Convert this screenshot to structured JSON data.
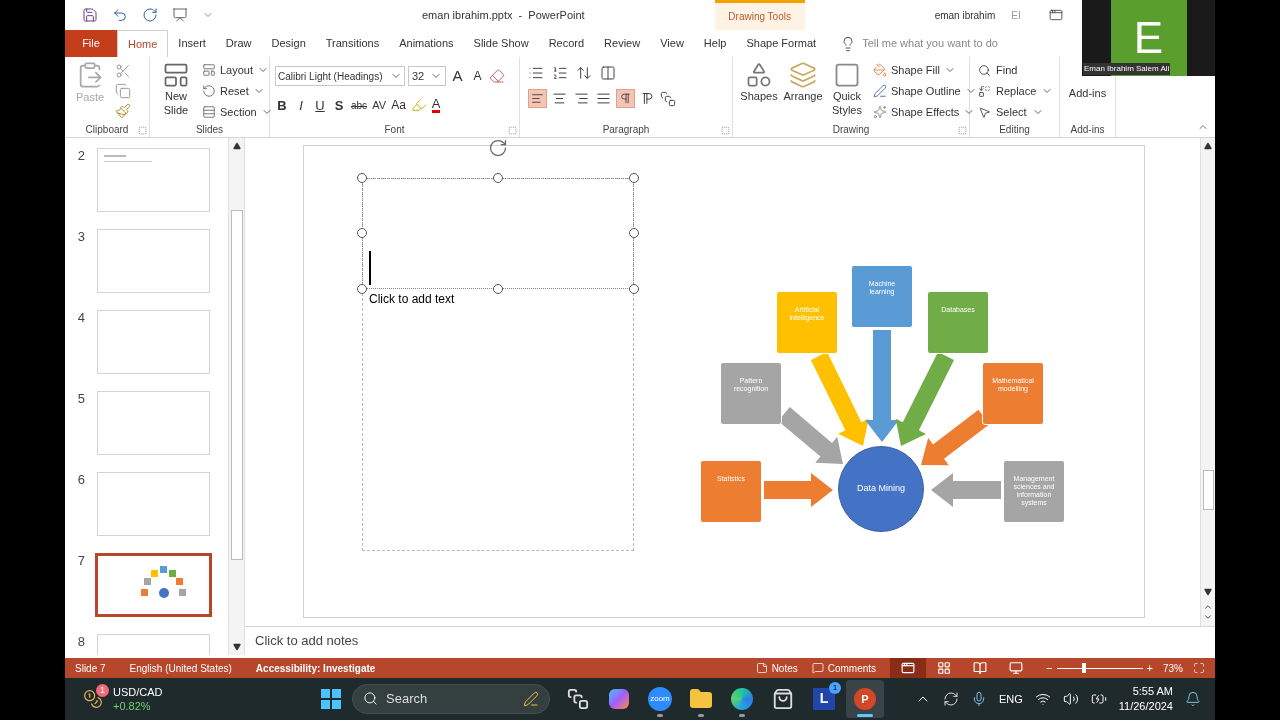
{
  "title_bar": {
    "title": "eman ibrahim.pptx  -  PowerPoint",
    "context_tab": "Drawing Tools",
    "user_name": "eman ibrahim",
    "user_initials": "EI"
  },
  "video_tile": {
    "letter": "E",
    "name": "Eman Ibrahim Salem Ali"
  },
  "tabs": [
    {
      "label": "File",
      "kind": "file",
      "selected": false
    },
    {
      "label": "Home",
      "kind": "tab",
      "selected": true
    },
    {
      "label": "Insert",
      "kind": "tab",
      "selected": false
    },
    {
      "label": "Draw",
      "kind": "tab",
      "selected": false
    },
    {
      "label": "Design",
      "kind": "tab",
      "selected": false
    },
    {
      "label": "Transitions",
      "kind": "tab",
      "selected": false
    },
    {
      "label": "Animations",
      "kind": "tab",
      "selected": false
    },
    {
      "label": "Slide Show",
      "kind": "tab",
      "selected": false
    },
    {
      "label": "Record",
      "kind": "tab",
      "selected": false
    },
    {
      "label": "Review",
      "kind": "tab",
      "selected": false
    },
    {
      "label": "View",
      "kind": "tab",
      "selected": false
    },
    {
      "label": "Help",
      "kind": "tab",
      "selected": false
    },
    {
      "label": "Shape Format",
      "kind": "tab",
      "selected": false
    }
  ],
  "tell_me": {
    "placeholder": "Tell me what you want to do"
  },
  "ribbon": {
    "clipboard": {
      "label": "Clipboard",
      "paste": {
        "label": "Paste",
        "disabled": true
      }
    },
    "slides": {
      "label": "Slides",
      "new_slide": "New Slide",
      "items": [
        "Layout",
        "Reset",
        "Section"
      ]
    },
    "font": {
      "label": "Font",
      "font_name": "Calibri Light (Headings)",
      "font_size": "32",
      "grow": "A",
      "shrink": "A",
      "styles": [
        {
          "kind": "bold",
          "label": "B"
        },
        {
          "kind": "italic",
          "label": "I"
        },
        {
          "kind": "underline",
          "label": "U"
        },
        {
          "kind": "shadow",
          "label": "S"
        },
        {
          "kind": "strike",
          "label": "abc"
        },
        {
          "kind": "spacing",
          "label": "AV"
        },
        {
          "kind": "case",
          "label": "Aa"
        }
      ],
      "color_letter": "A"
    },
    "paragraph": {
      "label": "Paragraph",
      "alignments": [
        {
          "kind": "left",
          "selected": true
        },
        {
          "kind": "center",
          "selected": false
        },
        {
          "kind": "right",
          "selected": false
        },
        {
          "kind": "justify",
          "selected": false
        }
      ],
      "directions": [
        {
          "kind": "ltr",
          "selected": true
        },
        {
          "kind": "rtl",
          "selected": false
        }
      ]
    },
    "drawing": {
      "label": "Drawing",
      "big": [
        "Shapes",
        "Arrange",
        "Quick Styles"
      ],
      "items": [
        "Shape Fill",
        "Shape Outline",
        "Shape Effects"
      ]
    },
    "editing": {
      "label": "Editing",
      "items": [
        "Find",
        "Replace",
        "Select"
      ]
    },
    "addins": {
      "label": "Add-ins",
      "button": "Add-ins"
    }
  },
  "thumbnails": [
    {
      "number": "2",
      "kind": "text",
      "selected": false
    },
    {
      "number": "3",
      "kind": "blank",
      "selected": false
    },
    {
      "number": "4",
      "kind": "blank",
      "selected": false
    },
    {
      "number": "5",
      "kind": "blank",
      "selected": false
    },
    {
      "number": "6",
      "kind": "blank",
      "selected": false
    },
    {
      "number": "7",
      "kind": "diagram",
      "selected": true
    },
    {
      "number": "8",
      "kind": "blank",
      "selected": false
    }
  ],
  "slide": {
    "placeholder": "Click to add text",
    "diagram": {
      "center": "Data Mining",
      "nodes": [
        {
          "label": "Artificial intelligence",
          "color": "#ffc000"
        },
        {
          "label": "Machine learning",
          "color": "#5b9bd5"
        },
        {
          "label": "Databases",
          "color": "#70ad47"
        },
        {
          "label": "Pattern recognition",
          "color": "#a5a5a5"
        },
        {
          "label": "Mathematical modelling",
          "color": "#ed7d31"
        },
        {
          "label": "Statistics",
          "color": "#ed7d31"
        },
        {
          "label": "Management sciences and information systems",
          "color": "#a5a5a5"
        }
      ]
    }
  },
  "notes": {
    "placeholder": "Click to add notes"
  },
  "status_bar": {
    "slide": "Slide 7",
    "language": "English (United States)",
    "accessibility": "Accessibility: Investigate",
    "notes": "Notes",
    "comments": "Comments",
    "views": [
      {
        "kind": "normal",
        "selected": true
      },
      {
        "kind": "sorter",
        "selected": false
      },
      {
        "kind": "reading",
        "selected": false
      },
      {
        "kind": "show",
        "selected": false
      }
    ],
    "zoom": {
      "minus": "−",
      "plus": "+",
      "level": 0.32,
      "reading": "73%"
    }
  },
  "taskbar": {
    "widget": {
      "badge": "1",
      "title": "USD/CAD",
      "change": "+0.82%"
    },
    "search": {
      "placeholder": "Search"
    },
    "apps": [
      {
        "kind": "taskview",
        "running": false,
        "active": false
      },
      {
        "kind": "copilot",
        "running": false,
        "active": false
      },
      {
        "kind": "zoom",
        "label": "zoom",
        "running": true,
        "active": false
      },
      {
        "kind": "folder",
        "running": true,
        "active": false
      },
      {
        "kind": "edge",
        "running": true,
        "active": false
      },
      {
        "kind": "store",
        "running": false,
        "active": false
      },
      {
        "kind": "lapp",
        "label": "L",
        "badge": "1",
        "running": false,
        "active": false
      },
      {
        "kind": "powerpoint",
        "label": "P",
        "running": true,
        "active": true
      }
    ],
    "language": "ENG",
    "time": "5:55 AM",
    "date": "11/26/2024"
  }
}
